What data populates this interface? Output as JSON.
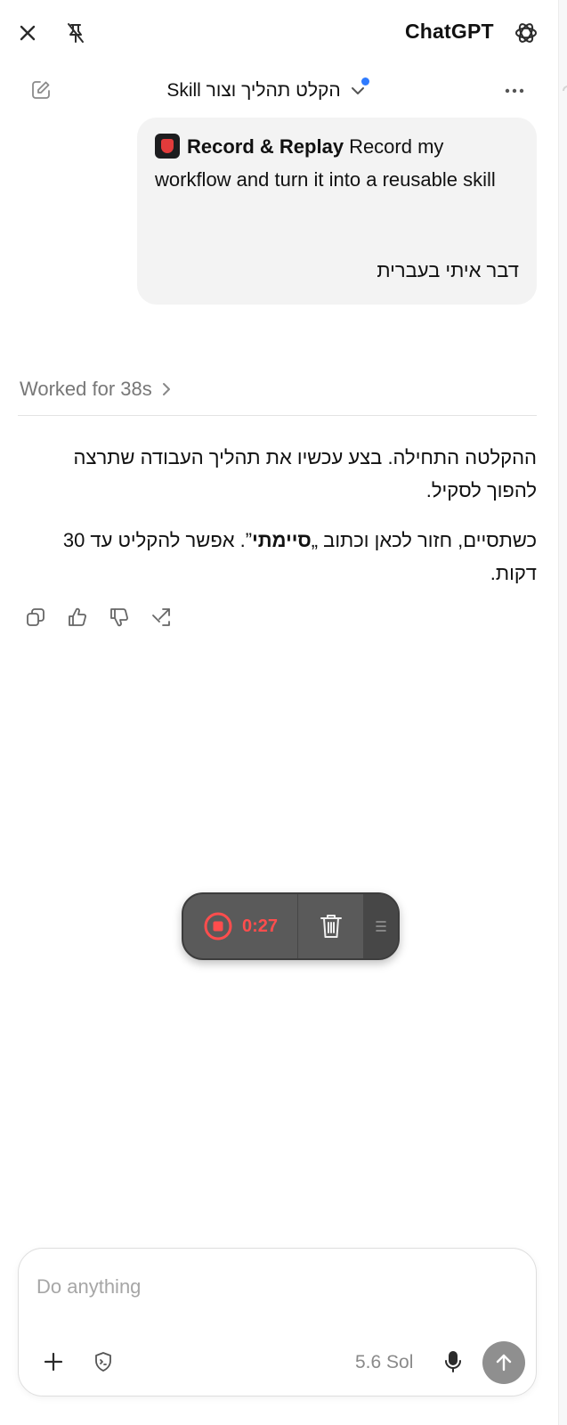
{
  "app": {
    "title": "ChatGPT"
  },
  "conversation": {
    "title": "הקלט תהליך וצור Skill"
  },
  "user_message": {
    "skill_chip_label": "Record & Replay",
    "text": "Record my workflow and turn it into a reusable skill",
    "rtl_text": "דבר איתי בעברית"
  },
  "worked": {
    "label": "Worked for 38s"
  },
  "assistant_message": {
    "paragraph1": "ההקלטה התחילה. בצע עכשיו את תהליך העבודה שתרצה להפוך לסקיל.",
    "paragraph2_before": "כשתסיים, חזור לכאן וכתוב „",
    "paragraph2_bold": "סיימתי",
    "paragraph2_after": "”. אפשר להקליט עד 30 דקות."
  },
  "recording": {
    "timer": "0:27"
  },
  "composer": {
    "placeholder": "Do anything",
    "value": "",
    "model_label": "5.6 Sol"
  },
  "colors": {
    "accent_blue": "#2f7bff",
    "record_red": "#ff4d4d",
    "pill_bg": "#5a5a5a",
    "send_disabled": "#8f8f8f"
  }
}
